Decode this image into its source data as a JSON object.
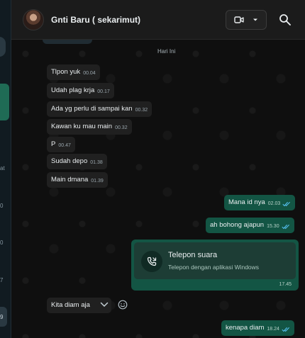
{
  "sidebar": {
    "visible_numbers": [
      "at",
      "0",
      "0",
      "7",
      "9"
    ]
  },
  "header": {
    "contact_name": "Gnti Baru ( sekarimut)",
    "video_icon": "video-camera-icon",
    "dropdown_icon": "caret-down-icon",
    "search_icon": "search-icon"
  },
  "chat": {
    "date_separator": "Hari Ini",
    "incoming": [
      {
        "text": "Tlpon yuk",
        "time": "00.04"
      },
      {
        "text": "Udah plag krja",
        "time": "00.17"
      },
      {
        "text": "Ada yg perlu di sampai kan",
        "time": "00.32"
      },
      {
        "text": "Kawan ku mau main",
        "time": "00.32"
      },
      {
        "text": "P",
        "time": "00.47"
      },
      {
        "text": "Sudah depo",
        "time": "01.38"
      },
      {
        "text": "Main dmana",
        "time": "01.39"
      }
    ],
    "outgoing": [
      {
        "text": "Mana id nya",
        "time": "02.03"
      },
      {
        "text": "ah bohong ajapun",
        "time": "15.30"
      }
    ],
    "call": {
      "title": "Telepon suara",
      "subtitle": "Telepon dengan aplikasi Windows",
      "time": "17.45"
    },
    "hovered_incoming": {
      "text": "Kita diam aja"
    },
    "last_outgoing": {
      "text": "kenapa diam",
      "time": "18.24"
    }
  },
  "colors": {
    "header_bg": "#1b1b1b",
    "chat_bg": "#0f0f0f",
    "incoming_bubble": "#202020",
    "outgoing_bubble": "#135544",
    "read_tick": "#53bdeb"
  }
}
